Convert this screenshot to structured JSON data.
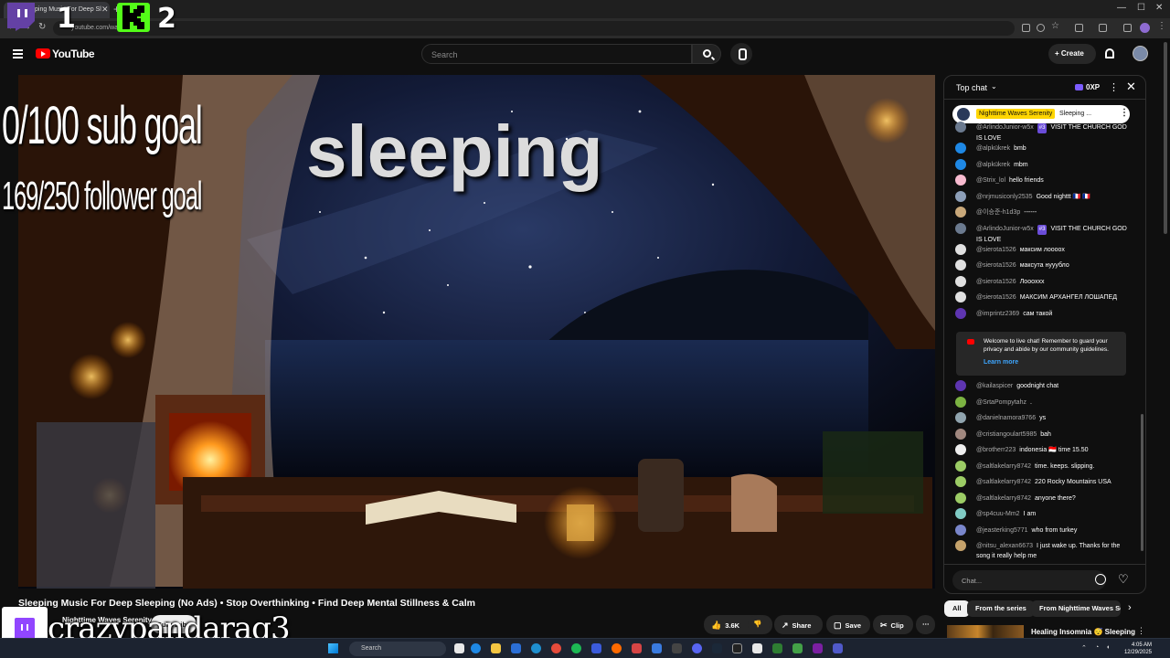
{
  "browser": {
    "tab_title": "Sleeping Music For Deep Sl",
    "url": "youtube.com/wa... ...UC..."
  },
  "overlay": {
    "num1": "1",
    "num2": "2",
    "sub_goal": "0/100 sub goal",
    "follower_goal": "169/250 follower goal",
    "sleeping": "sleeping",
    "streamer_name": "crazypandarag3"
  },
  "header": {
    "logo": "YouTube",
    "search_placeholder": "Search",
    "create_label": "Create"
  },
  "chat": {
    "title": "Top chat",
    "xp": "0XP",
    "pinned": {
      "name": "Nighttime Waves Serenity",
      "text": "Sleeping ..."
    },
    "messages": [
      {
        "name": "@ArlindoJunior-w5x",
        "badge": "#3",
        "text": "VISIT THE CHURCH GOD IS LOVE",
        "color": "#6b7a8f"
      },
      {
        "name": "@alpkükrek",
        "badge": "",
        "text": "bmb",
        "color": "#1e88e5"
      },
      {
        "name": "@alpkükrek",
        "badge": "",
        "text": "mbm",
        "color": "#1e88e5"
      },
      {
        "name": "@Strix_lol",
        "badge": "",
        "text": "hello friends",
        "color": "#f8bbd0"
      },
      {
        "name": "@nrjmusiconly2535",
        "badge": "",
        "text": "Good nighttt 🇫🇷 🇫🇷",
        "color": "#8d9fb8"
      },
      {
        "name": "@이승준-h1d3p",
        "badge": "",
        "text": "------",
        "color": "#c9a87a"
      },
      {
        "name": "@ArlindoJunior-w5x",
        "badge": "#3",
        "text": "VISIT THE CHURCH GOD IS LOVE",
        "color": "#6b7a8f"
      },
      {
        "name": "@sierota1526",
        "badge": "",
        "text": "максим лоооох",
        "color": "#e0e0e0"
      },
      {
        "name": "@sierota1526",
        "badge": "",
        "text": "максута нууубло",
        "color": "#e0e0e0"
      },
      {
        "name": "@sierota1526",
        "badge": "",
        "text": "Лоооxxx",
        "color": "#e0e0e0"
      },
      {
        "name": "@sierota1526",
        "badge": "",
        "text": "МАКСИМ АРХАНГЕЛ ЛОШАПЕД",
        "color": "#e0e0e0"
      },
      {
        "name": "@imprintz2369",
        "badge": "",
        "text": "сам такой",
        "color": "#5e35b1"
      }
    ],
    "welcome_text": "Welcome to live chat! Remember to guard your privacy and abide by our community guidelines.",
    "welcome_link": "Learn more",
    "messages2": [
      {
        "name": "@kailaspicer",
        "badge": "",
        "text": "goodnight chat",
        "color": "#5e35b1"
      },
      {
        "name": "@SrtaPompytahz",
        "badge": "",
        "text": ".",
        "color": "#7cb342"
      },
      {
        "name": "@danielnamora9766",
        "badge": "",
        "text": "ys",
        "color": "#90a4ae"
      },
      {
        "name": "@cristiangoulart5985",
        "badge": "",
        "text": "bah",
        "color": "#a1887f"
      },
      {
        "name": "@brotherr223",
        "badge": "",
        "text": "indonesia 🇮🇩 time 15.50",
        "color": "#eeeeee"
      },
      {
        "name": "@saltlakelarry8742",
        "badge": "",
        "text": "time. keeps. slipping.",
        "color": "#9ccc65"
      },
      {
        "name": "@saltlakelarry8742",
        "badge": "",
        "text": "220 Rocky Mountains USA",
        "color": "#9ccc65"
      },
      {
        "name": "@saltlakelarry8742",
        "badge": "",
        "text": "anyone there?",
        "color": "#9ccc65"
      },
      {
        "name": "@sp4cuu-Mm2",
        "badge": "",
        "text": "I am",
        "color": "#80cbc4"
      },
      {
        "name": "@jeasterking5771",
        "badge": "",
        "text": "who from turkey",
        "color": "#7986cb"
      },
      {
        "name": "@nitsu_alexan6673",
        "badge": "",
        "text": "I just wake up. Thanks for the song it really help me",
        "color": "#c5a26b"
      }
    ],
    "input_placeholder": "Chat..."
  },
  "video": {
    "title": "Sleeping Music For Deep Sleeping (No Ads) • Stop Overthinking • Find Deep Mental Stillness & Calm",
    "channel": "Nighttime Waves Serenity",
    "subscribe": "Subscribe",
    "likes": "3.6K",
    "share": "Share",
    "save": "Save",
    "clip": "Clip"
  },
  "related": {
    "chips": [
      "All",
      "From the series",
      "From Nighttime Waves Se"
    ],
    "first_title": "Healing Insomnia 😴 Sleeping"
  },
  "taskbar": {
    "search": "Search",
    "time": "4:05 AM",
    "date": "12/29/2025"
  },
  "colors": {
    "accent_red": "#ff0000",
    "chat_bg": "#0f0f0f",
    "pinned_highlight": "#ffd600",
    "kick_green": "#53fc18",
    "twitch_purple": "#9146ff"
  }
}
